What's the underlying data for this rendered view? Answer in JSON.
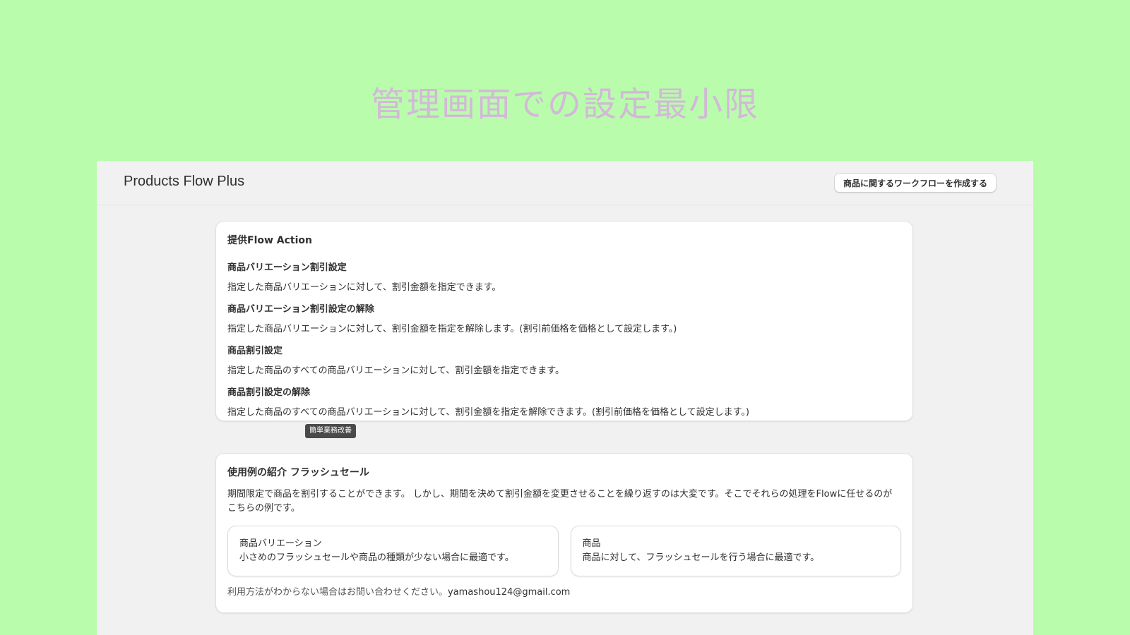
{
  "hero": {
    "title": "管理画面での設定最小限"
  },
  "app": {
    "title": "Products Flow Plus",
    "create_button": "商品に関するワークフローを作成する"
  },
  "actions_card": {
    "title": "提供Flow Action",
    "items": [
      {
        "title": "商品バリエーション割引設定",
        "desc": "指定した商品バリエーションに対して、割引金額を指定できます。"
      },
      {
        "title": "商品バリエーション割引設定の解除",
        "desc": "指定した商品バリエーションに対して、割引金額を指定を解除します。(割引前価格を価格として設定します。)"
      },
      {
        "title": "商品割引設定",
        "desc": "指定した商品のすべての商品バリエーションに対して、割引金額を指定できます。"
      },
      {
        "title": "商品割引設定の解除",
        "desc": "指定した商品のすべての商品バリエーションに対して、割引金額を指定を解除できます。(割引前価格を価格として設定します。)"
      }
    ],
    "badge": "簡単業務改善"
  },
  "usecase_card": {
    "title": "使用例の紹介 フラッシュセール",
    "intro": "期間限定で商品を割引することができます。 しかし、期間を決めて割引金額を変更させることを繰り返すのは大変です。そこでそれらの処理をFlowに任せるのがこちらの例です。",
    "boxes": [
      {
        "title": "商品バリエーション",
        "desc": "小さめのフラッシュセールや商品の種類が少ない場合に最適です。"
      },
      {
        "title": "商品",
        "desc": "商品に対して、フラッシュセールを行う場合に最適です。"
      }
    ],
    "contact_text": "利用方法がわからない場合はお問い合わせください。",
    "contact_email": "yamashou124@gmail.com"
  }
}
